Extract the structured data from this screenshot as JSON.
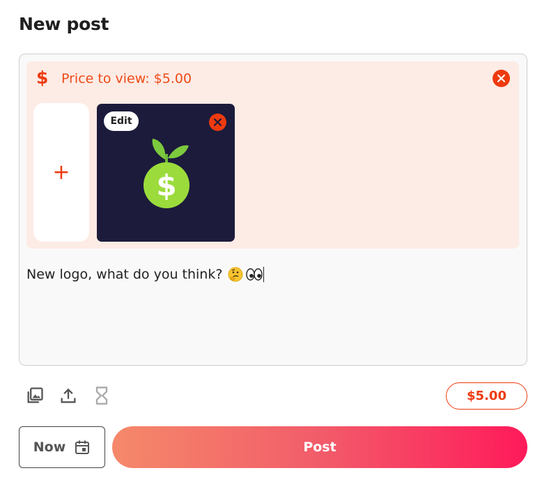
{
  "header": {
    "title": "New post"
  },
  "price_panel": {
    "icon": "dollar-icon",
    "label": "Price to view: $5.00",
    "remove_icon": "close-icon"
  },
  "media": {
    "add_label": "+",
    "items": [
      {
        "edit_label": "Edit",
        "remove_icon": "close-icon",
        "image": "green-dollar-apple-logo"
      }
    ]
  },
  "caption": {
    "text": "New logo, what do you think?",
    "emojis": [
      "thinking-face",
      "eyes"
    ]
  },
  "toolbar": {
    "icons": [
      "gallery-icon",
      "upload-icon",
      "hourglass-icon"
    ],
    "price_button": "$5.00"
  },
  "actions": {
    "schedule_label": "Now",
    "schedule_icon": "calendar-icon",
    "post_label": "Post"
  },
  "colors": {
    "accent": "#ee3a0e",
    "panel_bg": "#fdebe5",
    "post_gradient_start": "#f5896a",
    "post_gradient_end": "#ff1a5a",
    "media_bg": "#1c1b3c"
  }
}
